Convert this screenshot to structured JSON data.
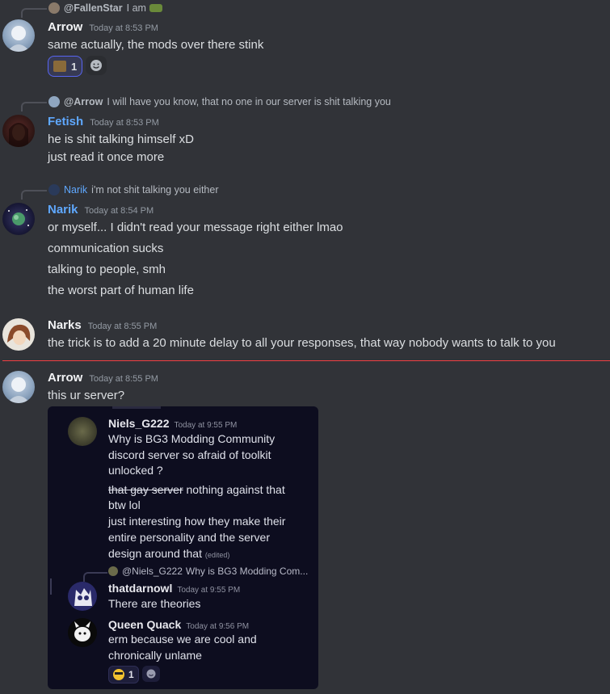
{
  "messages": [
    {
      "reply": {
        "icon": "cat-icon",
        "author": "@FallenStar",
        "text": "I am",
        "emoji": "sunglasses-emoji"
      },
      "author": "Arrow",
      "author_color": "#f2f3f5",
      "timestamp": "Today at 8:53 PM",
      "lines": [
        "same actually, the mods over there stink"
      ],
      "reactions": [
        {
          "emoji": "cake-emoji",
          "count": "1"
        }
      ]
    },
    {
      "reply": {
        "icon": "avatar-icon",
        "author": "@Arrow",
        "text": "I will have you know, that no one in our server is shit talking you"
      },
      "author": "Fetish",
      "author_color": "#5fa8ff",
      "timestamp": "Today at 8:53 PM",
      "lines": [
        "he is shit talking himself xD",
        "just read it once more"
      ]
    },
    {
      "reply": {
        "icon": "planet-icon",
        "author": "Narik",
        "text": "i'm not shit talking you either",
        "author_color": "#5fa8ff"
      },
      "author": "Narik",
      "author_color": "#5fa8ff",
      "timestamp": "Today at 8:54 PM",
      "lines": [
        "or myself... I didn't read your message right either lmao",
        "communication sucks",
        "talking to people, smh",
        "the worst part of human life"
      ]
    },
    {
      "author": "Narks",
      "author_color": "#f2f3f5",
      "timestamp": "Today at 8:55 PM",
      "lines": [
        "the trick is to add a 20 minute delay to all your responses, that way nobody wants to talk to you"
      ]
    },
    {
      "author": "Arrow",
      "author_color": "#f2f3f5",
      "timestamp": "Today at 8:55 PM",
      "lines": [
        "this ur server?"
      ]
    }
  ],
  "embed": {
    "msg1": {
      "author": "Niels_G222",
      "timestamp": "Today at 9:55 PM",
      "lines": [
        "Why is BG3 Modding Community",
        "discord server so afraid of toolkit",
        "unlocked ?"
      ],
      "strike": "that gay server",
      "after_strike": " nothing against that",
      "lines2": [
        "btw lol",
        "just interesting how they make their",
        "entire personality and the server"
      ],
      "last": "design around that",
      "edited": "(edited)"
    },
    "reply": {
      "author": "@Niels_G222",
      "text": "Why is BG3 Modding Com..."
    },
    "msg2": {
      "author": "thatdarnowl",
      "timestamp": "Today at 9:55 PM",
      "lines": [
        "There are theories"
      ]
    },
    "msg3": {
      "author": "Queen Quack",
      "timestamp": "Today at 9:56 PM",
      "lines": [
        "erm because we are cool and",
        "chronically unlame"
      ],
      "reaction_count": "1"
    }
  }
}
